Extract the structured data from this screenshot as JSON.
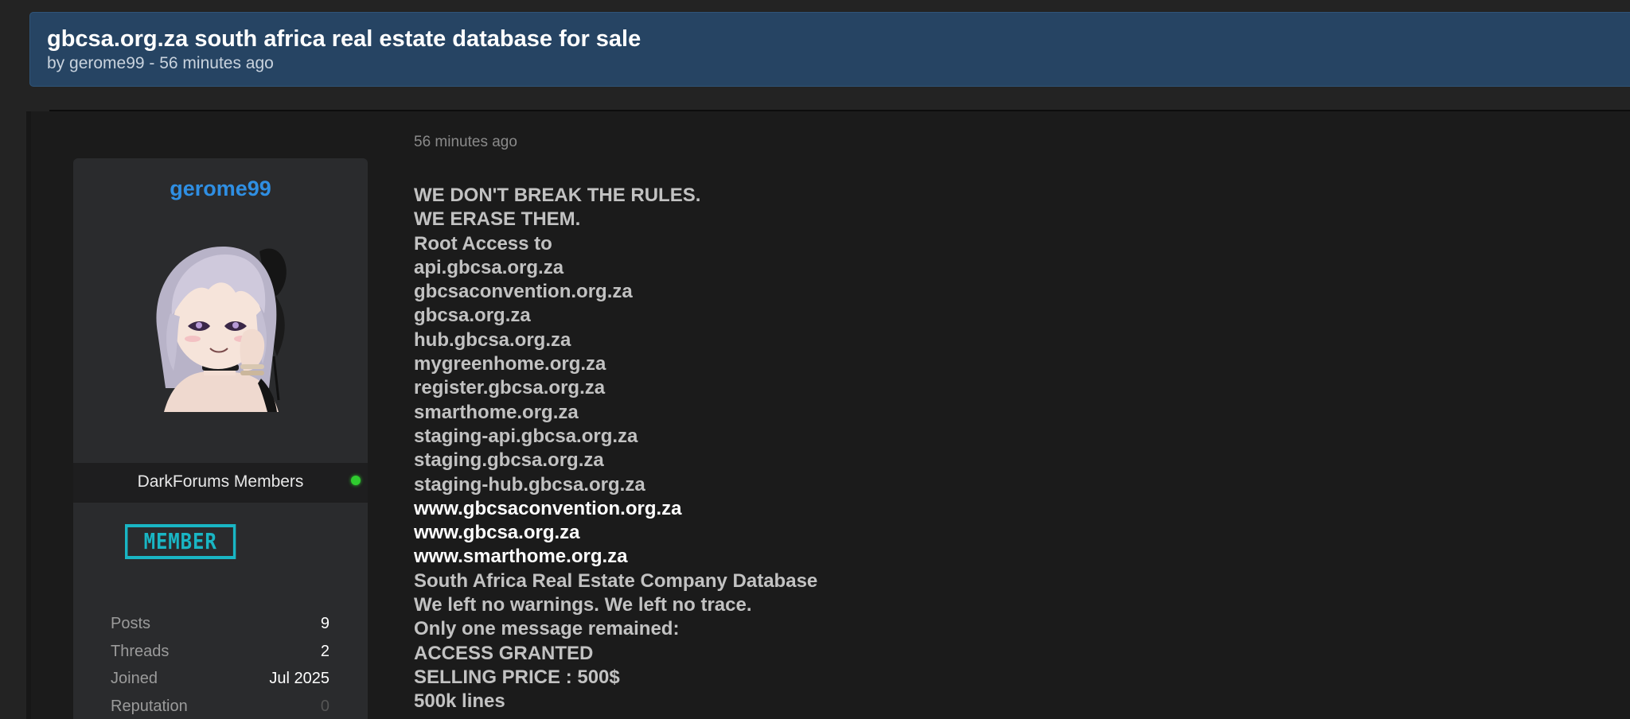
{
  "thread": {
    "title": "gbcsa.org.za south africa real estate database for sale",
    "meta": "by gerome99 - 56 minutes ago"
  },
  "post": {
    "date": "56 minutes ago",
    "lines": [
      {
        "text": "WE DON'T BREAK THE RULES.",
        "bright": false
      },
      {
        "text": "WE ERASE THEM.",
        "bright": false
      },
      {
        "text": "Root Access to",
        "bright": false
      },
      {
        "text": "api.gbcsa.org.za",
        "bright": false
      },
      {
        "text": "gbcsaconvention.org.za",
        "bright": false
      },
      {
        "text": "gbcsa.org.za",
        "bright": false
      },
      {
        "text": "hub.gbcsa.org.za",
        "bright": false
      },
      {
        "text": "mygreenhome.org.za",
        "bright": false
      },
      {
        "text": "register.gbcsa.org.za",
        "bright": false
      },
      {
        "text": "smarthome.org.za",
        "bright": false
      },
      {
        "text": "staging-api.gbcsa.org.za",
        "bright": false
      },
      {
        "text": "staging.gbcsa.org.za",
        "bright": false
      },
      {
        "text": "staging-hub.gbcsa.org.za",
        "bright": false
      },
      {
        "text": "www.gbcsaconvention.org.za",
        "bright": true
      },
      {
        "text": "www.gbcsa.org.za",
        "bright": true
      },
      {
        "text": "www.smarthome.org.za",
        "bright": true
      },
      {
        "text": "South Africa Real Estate Company Database",
        "bright": false
      },
      {
        "text": "We left no warnings. We left no trace.",
        "bright": false
      },
      {
        "text": "Only one message remained:",
        "bright": false
      },
      {
        "text": "ACCESS GRANTED",
        "bright": false
      },
      {
        "text": "SELLING PRICE : 500$",
        "bright": false
      },
      {
        "text": "500k lines",
        "bright": false
      }
    ]
  },
  "author": {
    "username": "gerome99",
    "group": "DarkForums Members",
    "badge": "MEMBER",
    "online": true,
    "stats": [
      {
        "label": "Posts",
        "value": "9"
      },
      {
        "label": "Threads",
        "value": "2"
      },
      {
        "label": "Joined",
        "value": "Jul 2025"
      },
      {
        "label": "Reputation",
        "value": "0"
      }
    ]
  },
  "colors": {
    "header_bg": "#264463",
    "username": "#2f8fe3",
    "badge": "#19b6c4",
    "online": "#2fcc2f"
  }
}
